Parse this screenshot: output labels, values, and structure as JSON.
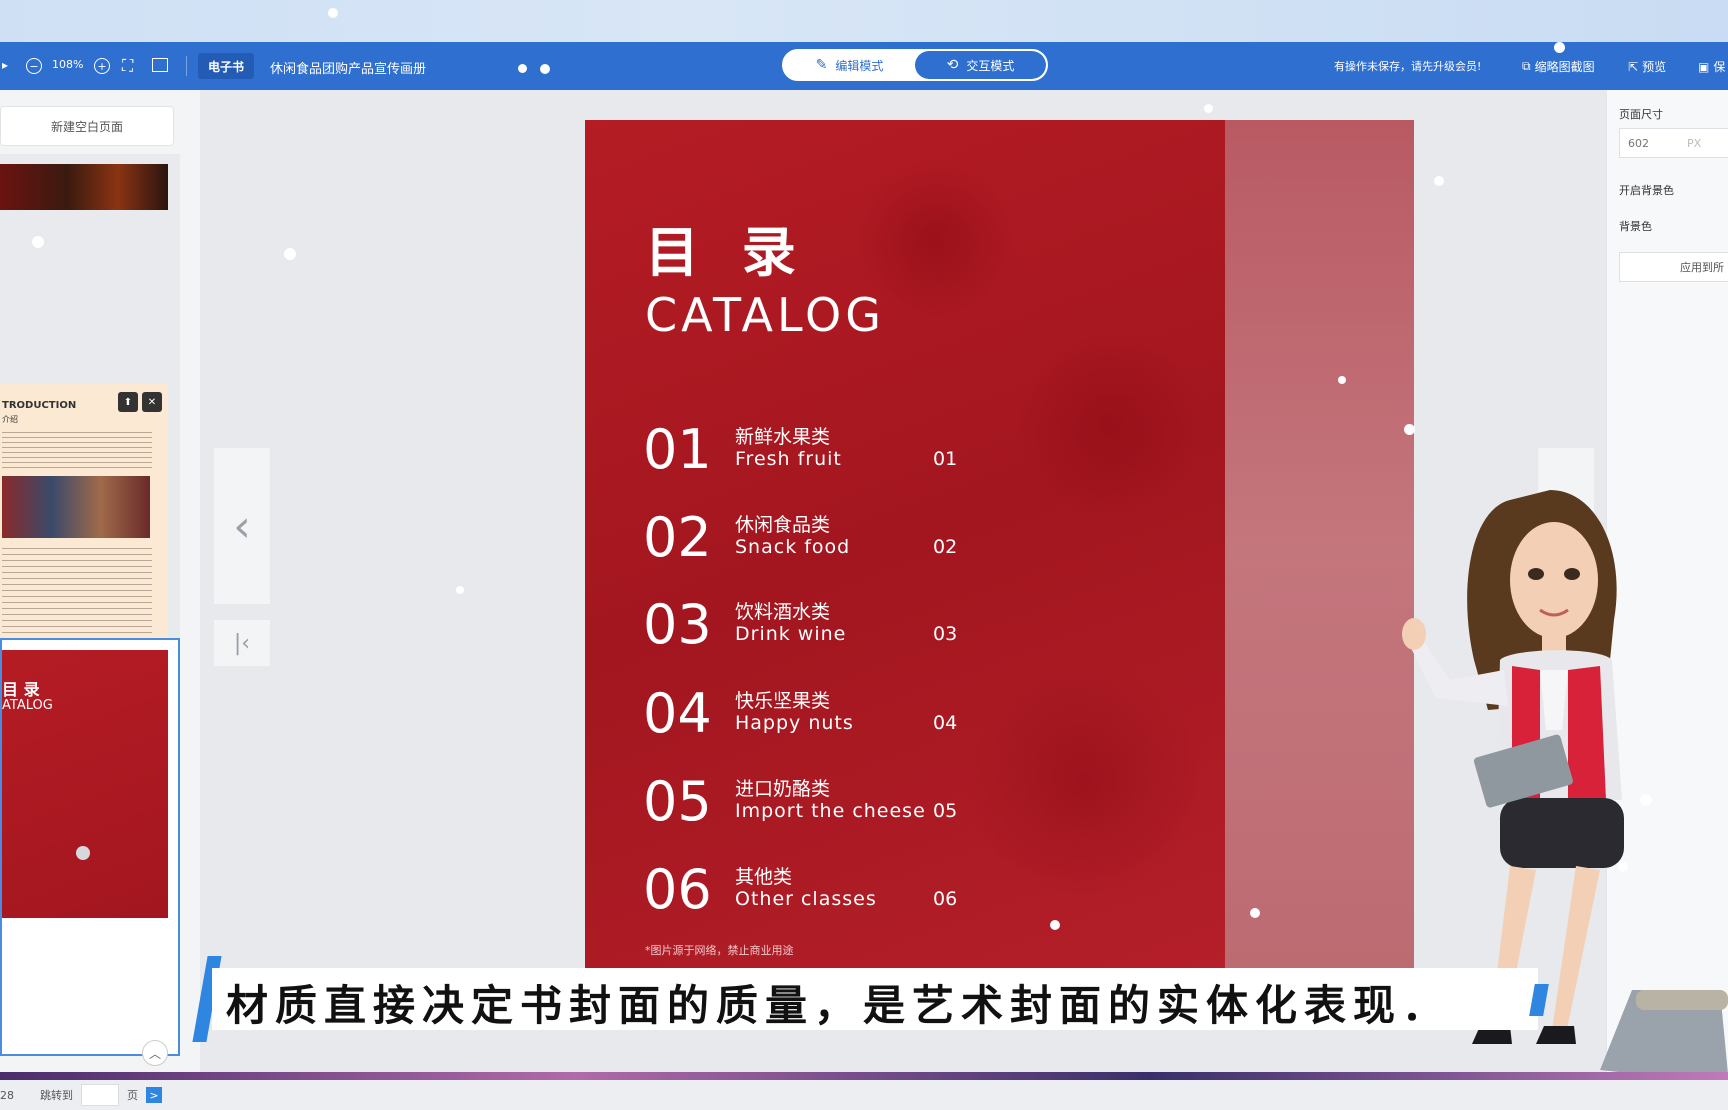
{
  "toolbar": {
    "zoom": "108%",
    "doc_type_badge": "电子书",
    "doc_title": "休闲食品团购产品宣传画册",
    "mode_edit": "编辑模式",
    "mode_interact": "交互模式",
    "unsaved_notice": "有操作未保存，请先升级会员!",
    "thumbnail_capture": "缩略图截图",
    "preview": "预览",
    "save": "保"
  },
  "sidebar": {
    "new_page": "新建空白页面",
    "thumbs": [
      {
        "heading": "TRODUCTION",
        "sub": "介绍"
      },
      {
        "heading_cn": "目 录",
        "heading_en": "ATALOG"
      }
    ],
    "pager": {
      "total": "28",
      "jump_label": "跳转到",
      "page_suffix": "页",
      "go": ">"
    }
  },
  "page": {
    "title_cn": "目 录",
    "title_en": "CATALOG",
    "catalog": [
      {
        "num": "01",
        "cn": "新鲜水果类",
        "en": "Fresh fruit",
        "page": "01"
      },
      {
        "num": "02",
        "cn": "休闲食品类",
        "en": "Snack food",
        "page": "02"
      },
      {
        "num": "03",
        "cn": "饮料酒水类",
        "en": "Drink wine",
        "page": "03"
      },
      {
        "num": "04",
        "cn": "快乐坚果类",
        "en": "Happy nuts",
        "page": "04"
      },
      {
        "num": "05",
        "cn": "进口奶酪类",
        "en": "Import the cheese",
        "page": "05"
      },
      {
        "num": "06",
        "cn": "其他类",
        "en": "Other classes",
        "page": "06"
      }
    ],
    "note": "*图片源于网络，禁止商业用途"
  },
  "right_panel": {
    "page_size_label": "页面尺寸",
    "page_size_value": "602",
    "unit": "PX",
    "bg_toggle_label": "开启背景色",
    "bg_color_label": "背景色",
    "apply_all": "应用到所"
  },
  "subtitle": "材质直接决定书封面的质量，是艺术封面的实体化表现．",
  "colors": {
    "toolbar": "#2f6fd0",
    "page_red": "#a9171f",
    "accent_blue": "#2f86e0"
  }
}
